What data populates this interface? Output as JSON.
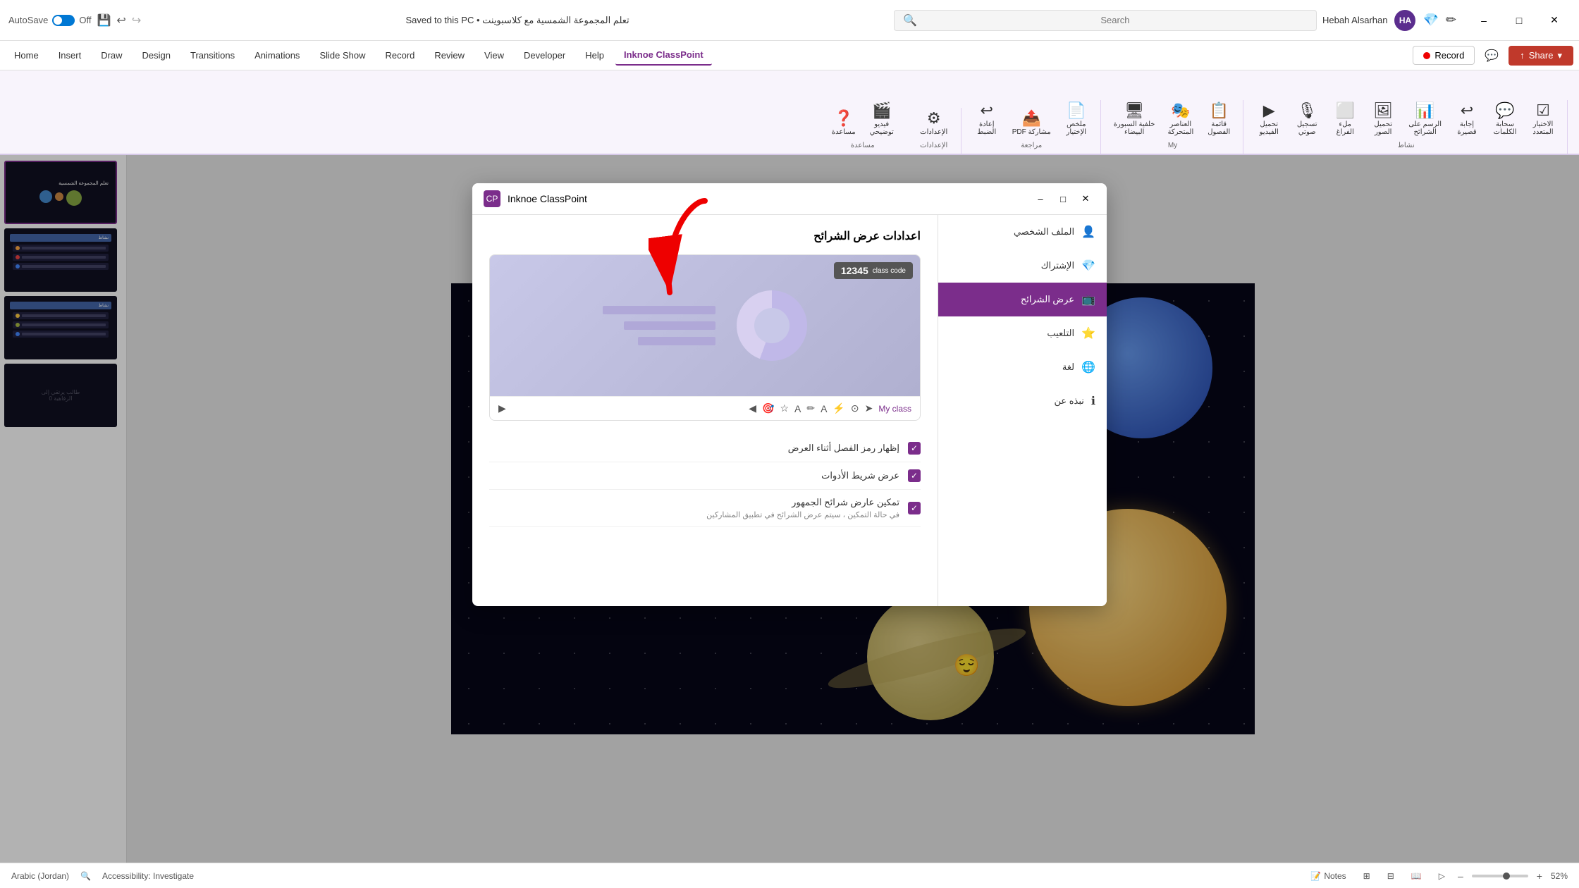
{
  "titlebar": {
    "autosave_label": "AutoSave",
    "autosave_state": "Off",
    "title": "تعلم المجموعة الشمسية مع كلاسبوينت • Saved to this PC",
    "search_placeholder": "Search",
    "user_name": "Hebah Alsarhan",
    "user_initials": "HA",
    "minimize": "–",
    "maximize": "□",
    "close": "✕"
  },
  "menubar": {
    "items": [
      {
        "label": "Home",
        "active": false
      },
      {
        "label": "Insert",
        "active": false
      },
      {
        "label": "Draw",
        "active": false
      },
      {
        "label": "Design",
        "active": false
      },
      {
        "label": "Transitions",
        "active": false
      },
      {
        "label": "Animations",
        "active": false
      },
      {
        "label": "Slide Show",
        "active": false
      },
      {
        "label": "Record",
        "active": false
      },
      {
        "label": "Review",
        "active": false
      },
      {
        "label": "View",
        "active": false
      },
      {
        "label": "Developer",
        "active": false
      },
      {
        "label": "Help",
        "active": false
      },
      {
        "label": "Inknoe ClassPoint",
        "active": true
      }
    ],
    "record_btn": "Record",
    "share_btn": "Share"
  },
  "ribbon": {
    "groups": [
      {
        "label": "نشاط",
        "items": [
          {
            "icon": "☑",
            "label": "الاختيار\nالمتعدد"
          },
          {
            "icon": "💬",
            "label": "سحابة\nالكلمات"
          },
          {
            "icon": "↩",
            "label": "إجابة\nقصيرة"
          },
          {
            "icon": "📊",
            "label": "الرسم على\nالشرائح"
          },
          {
            "icon": "🖼",
            "label": "تحميل\nالصور"
          },
          {
            "icon": "⬜",
            "label": "ملء\nالفراغ"
          },
          {
            "icon": "🎙",
            "label": "تسجيل\nصوتي"
          },
          {
            "icon": "▶",
            "label": "تحميل\nالفيديو"
          }
        ]
      },
      {
        "label": "My",
        "items": [
          {
            "icon": "📋",
            "label": "قائمة\nالفصول"
          },
          {
            "icon": "🎭",
            "label": "العناصر\nالمتحركة"
          },
          {
            "icon": "🖥",
            "label": "خلفية السبورة\nالبيضاء"
          }
        ]
      },
      {
        "label": "مراجعة",
        "items": [
          {
            "icon": "📄",
            "label": "ملخص\nالإختيار"
          },
          {
            "icon": "📤",
            "label": "مشاركة PDF"
          },
          {
            "icon": "↩",
            "label": "إعادة\nالضبط"
          }
        ]
      },
      {
        "label": "الإعدادات",
        "items": [
          {
            "icon": "⚙",
            "label": "الإعدادات"
          }
        ]
      },
      {
        "label": "مساعدة",
        "items": [
          {
            "icon": "▶🎬",
            "label": "فيديو\nتوضيحي"
          },
          {
            "icon": "❓",
            "label": "مساعدة"
          }
        ]
      }
    ]
  },
  "dialog": {
    "title": "Inknoe ClassPoint",
    "icon": "CP",
    "header": "اعدادات عرض الشرائح",
    "nav_items": [
      {
        "label": "الملف الشخصي",
        "icon": "👤",
        "active": false
      },
      {
        "label": "الإشتراك",
        "icon": "💎",
        "active": false
      },
      {
        "label": "عرض الشرائح",
        "icon": "📺",
        "active": true
      },
      {
        "label": "التلعيب",
        "icon": "⭐",
        "active": false
      },
      {
        "label": "لغة",
        "icon": "🌐",
        "active": false
      },
      {
        "label": "نبذه عن",
        "icon": "ℹ",
        "active": false
      }
    ],
    "class_code_label": "class code",
    "class_code_value": "12345",
    "toolbar_items": [
      "My class",
      "➤",
      "⚙",
      "A",
      "✏",
      "A",
      "☰",
      "🎯",
      "◀",
      "▶"
    ],
    "checkboxes": [
      {
        "label": "إظهار رمز الفصل أثناء العرض",
        "checked": true,
        "sub_text": ""
      },
      {
        "label": "عرض شريط الأدوات",
        "checked": true,
        "sub_text": ""
      },
      {
        "label": "تمكين عارض شرائح الجمهور",
        "checked": true,
        "sub_text": "في حالة التمكين ، سيتم عرض الشرائح في تطبيق المشاركين"
      }
    ]
  },
  "statusbar": {
    "language": "Arabic (Jordan)",
    "accessibility": "Accessibility: Investigate",
    "notes": "Notes",
    "zoom": "52%",
    "view_normal_label": "Normal view",
    "view_slide_sorter_label": "Slide Sorter",
    "view_reading_label": "Reading View",
    "view_presenter_label": "Presenter View"
  }
}
